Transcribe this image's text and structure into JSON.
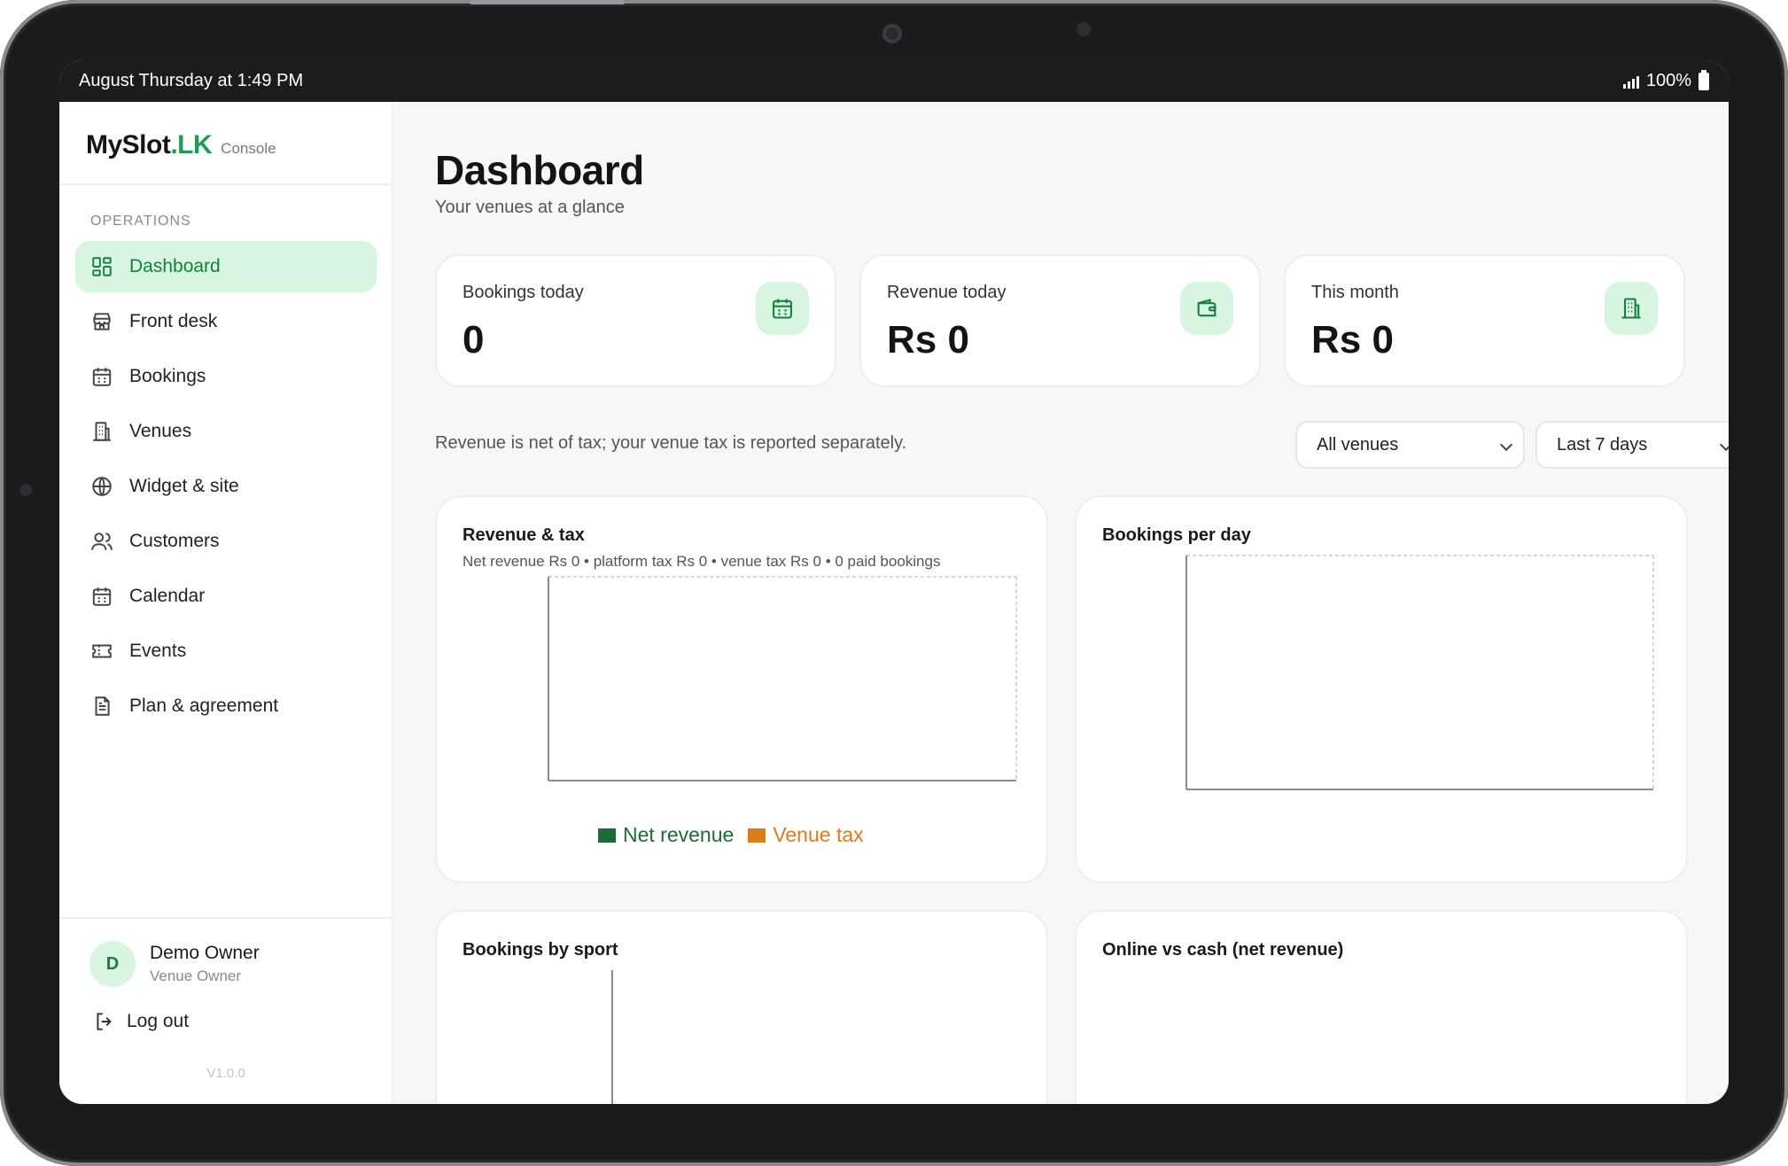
{
  "status_bar": {
    "time": "August Thursday at 1:49 PM",
    "battery": "100%"
  },
  "sidebar": {
    "brand": {
      "name": "MySlot",
      "suffix": ".LK",
      "tag": "Console"
    },
    "section": "OPERATIONS",
    "items": [
      {
        "label": "Dashboard",
        "icon": "dashboard-icon",
        "active": true
      },
      {
        "label": "Front desk",
        "icon": "store-icon"
      },
      {
        "label": "Bookings",
        "icon": "calendar-icon"
      },
      {
        "label": "Venues",
        "icon": "building-icon"
      },
      {
        "label": "Widget & site",
        "icon": "globe-icon"
      },
      {
        "label": "Customers",
        "icon": "users-icon"
      },
      {
        "label": "Calendar",
        "icon": "calendar-icon"
      },
      {
        "label": "Events",
        "icon": "ticket-icon"
      },
      {
        "label": "Plan & agreement",
        "icon": "document-icon"
      }
    ],
    "user": {
      "initial": "D",
      "name": "Demo Owner",
      "role": "Venue Owner"
    },
    "logout": "Log out",
    "version": "V1.0.0"
  },
  "main": {
    "title": "Dashboard",
    "subtitle": "Your venues at a glance",
    "stats": [
      {
        "label": "Bookings today",
        "value": "0",
        "icon": "calendar-icon"
      },
      {
        "label": "Revenue today",
        "value": "Rs 0",
        "icon": "wallet-icon"
      },
      {
        "label": "This month",
        "value": "Rs 0",
        "icon": "building-icon"
      }
    ],
    "note": "Revenue is net of tax; your venue tax is reported separately.",
    "filters": {
      "venue": "All venues",
      "range": "Last 7 days"
    },
    "cards": {
      "revenue": {
        "title": "Revenue & tax",
        "subtitle": "Net revenue Rs 0 • platform tax Rs 0 • venue tax Rs 0 • 0 paid bookings",
        "legend": [
          {
            "label": "Net revenue",
            "color": "#1e6b3a"
          },
          {
            "label": "Venue tax",
            "color": "#e07b1a"
          }
        ]
      },
      "per_day": {
        "title": "Bookings per day"
      },
      "by_sport": {
        "title": "Bookings by sport"
      },
      "online_cash": {
        "title": "Online vs cash (net revenue)"
      }
    }
  },
  "colors": {
    "accent": "#16803c",
    "accent_bg": "#d7f5e1",
    "brand_green": "#1f9d55"
  }
}
